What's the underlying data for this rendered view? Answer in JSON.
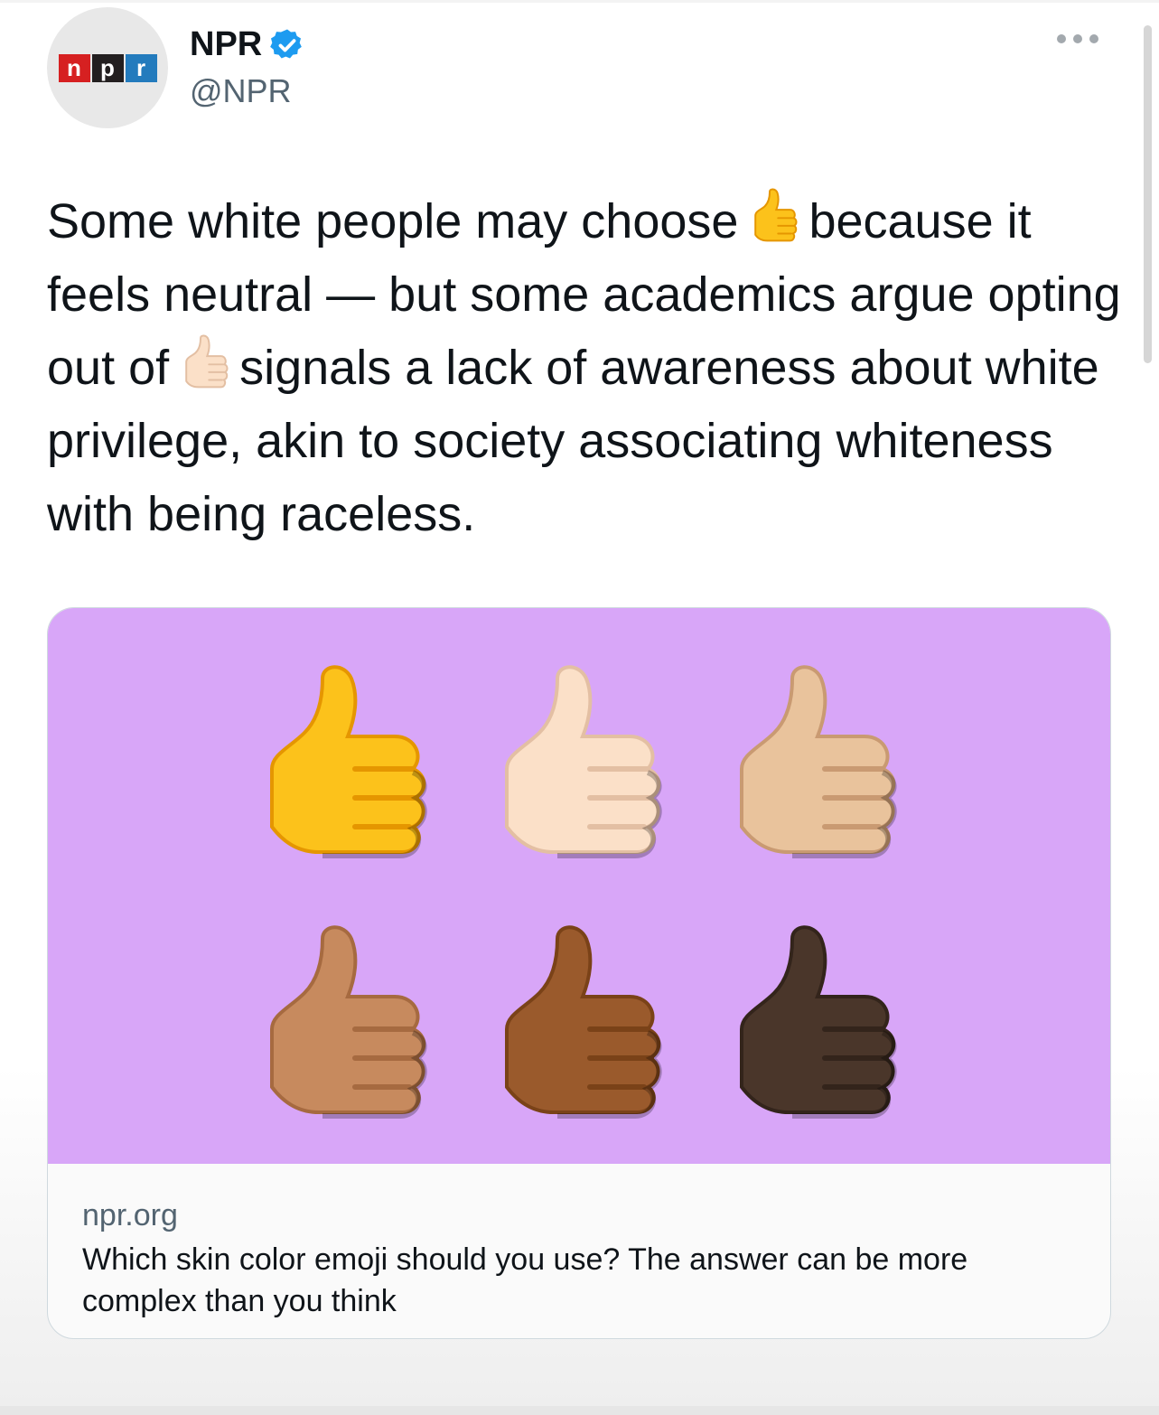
{
  "header": {
    "display_name": "NPR",
    "handle": "@NPR",
    "avatar_logo_letters": [
      "n",
      "p",
      "r"
    ],
    "logo_colors": [
      "#d62021",
      "#231f20",
      "#237bbd"
    ],
    "verified_icon": "verified-badge-icon",
    "verified_color": "#1d9bf0",
    "more_icon": "more-dots-icon"
  },
  "tweet": {
    "part1": "Some white people may choose",
    "part2": "because it feels neutral — but some academics argue opting out of",
    "part3": "signals a lack of awareness about white privilege, akin to society associating whiteness with being raceless.",
    "emoji_1": "thumbs-up-default-yellow-icon",
    "emoji_2": "thumbs-up-light-skin-tone-icon"
  },
  "link_card": {
    "domain": "npr.org",
    "title": "Which skin color emoji should you use? The answer can be more complex than you think",
    "image_background": "#d8a6f8",
    "thumbs": [
      {
        "name": "thumbs-up-yellow-icon",
        "skin": "#fcc21b",
        "shade": "#e59600"
      },
      {
        "name": "thumbs-up-light-icon",
        "skin": "#fbe0c8",
        "shade": "#e3bfa3"
      },
      {
        "name": "thumbs-up-medium-light-icon",
        "skin": "#e9c39c",
        "shade": "#c99a72"
      },
      {
        "name": "thumbs-up-medium-icon",
        "skin": "#c78a5e",
        "shade": "#a66a40"
      },
      {
        "name": "thumbs-up-medium-dark-icon",
        "skin": "#9a5a2c",
        "shade": "#7a4218"
      },
      {
        "name": "thumbs-up-dark-icon",
        "skin": "#4a362a",
        "shade": "#33241b"
      }
    ]
  }
}
